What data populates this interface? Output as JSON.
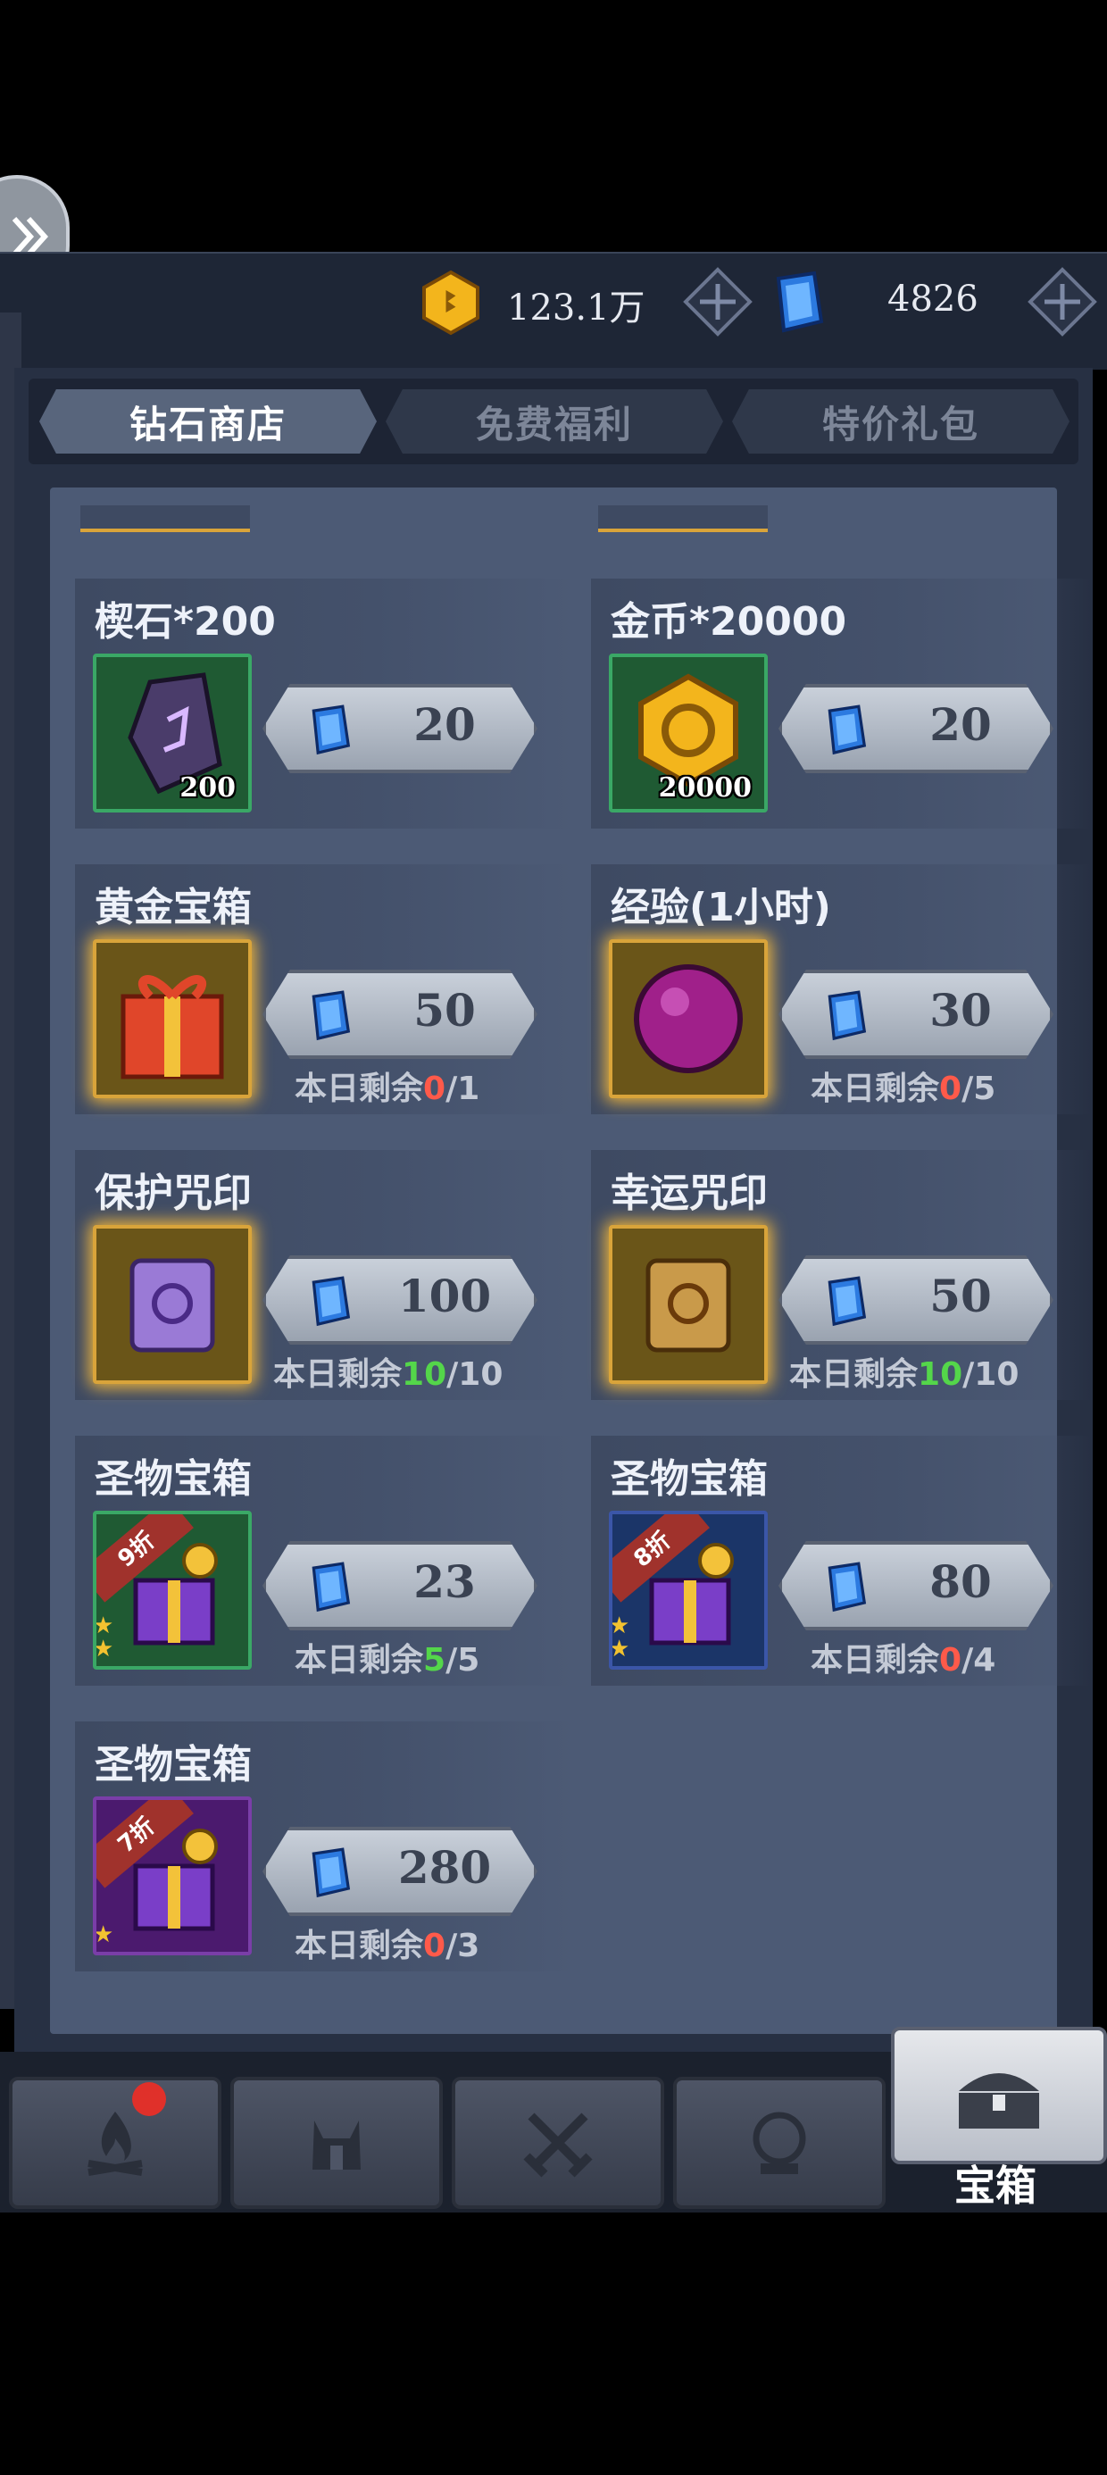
{
  "currency": {
    "gold": {
      "icon": "gold-coin-icon",
      "value": "123.1万"
    },
    "gems": {
      "icon": "blue-gem-icon",
      "value": "4826"
    }
  },
  "tabs": [
    {
      "label": "钻石商店",
      "active": true
    },
    {
      "label": "免费福利",
      "active": false
    },
    {
      "label": "特价礼包",
      "active": false
    }
  ],
  "items": [
    {
      "name": "楔石*200",
      "icon": "wedge-stone-icon",
      "qty": "200",
      "price": "20",
      "frame": "green"
    },
    {
      "name": "金币*20000",
      "icon": "gold-coin-icon",
      "qty": "20000",
      "price": "20",
      "frame": "green"
    },
    {
      "name": "黄金宝箱",
      "icon": "gift-box-icon",
      "price": "50",
      "frame": "gold",
      "limit_label": "本日剩余",
      "limit_used": "0",
      "limit_total": "/1"
    },
    {
      "name": "经验(1小时)",
      "icon": "exp-orb-icon",
      "price": "30",
      "frame": "gold",
      "limit_label": "本日剩余",
      "limit_used": "0",
      "limit_total": "/5"
    },
    {
      "name": "保护咒印",
      "icon": "purple-scroll-icon",
      "price": "100",
      "frame": "gold",
      "limit_label": "本日剩余",
      "limit_used": "10",
      "limit_total": "/10"
    },
    {
      "name": "幸运咒印",
      "icon": "gold-scroll-icon",
      "price": "50",
      "frame": "gold",
      "limit_label": "本日剩余",
      "limit_used": "10",
      "limit_total": "/10"
    },
    {
      "name": "圣物宝箱",
      "icon": "relic-chest-icon",
      "price": "23",
      "frame": "green",
      "discount": "9折",
      "limit_label": "本日剩余",
      "limit_used": "5",
      "limit_total": "/5"
    },
    {
      "name": "圣物宝箱",
      "icon": "relic-chest-icon",
      "price": "80",
      "frame": "blue",
      "discount": "8折",
      "limit_label": "本日剩余",
      "limit_used": "0",
      "limit_total": "/4"
    },
    {
      "name": "圣物宝箱",
      "icon": "relic-chest-icon",
      "price": "280",
      "frame": "purple",
      "discount": "7折",
      "limit_label": "本日剩余",
      "limit_used": "0",
      "limit_total": "/3"
    }
  ],
  "nav": {
    "buttons": [
      "campfire-icon",
      "helmet-icon",
      "crossed-swords-icon",
      "crystal-ball-icon"
    ],
    "active": {
      "icon": "treasure-chest-icon",
      "label": "宝箱"
    }
  },
  "colors": {
    "limit_zero": "#ff5a4a",
    "limit_full": "#54d64a",
    "gold_frame": "#d9a43a"
  }
}
